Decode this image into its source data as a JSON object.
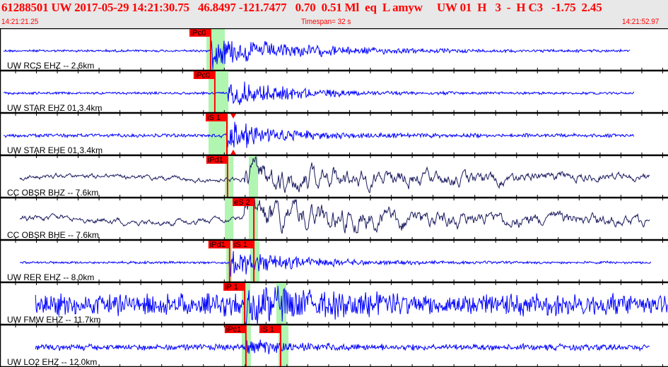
{
  "header": {
    "title": "61288501 UW 2017-05-29 14:21:30.75   46.8497 -121.7477   0.70  0.51 Ml  eq  L amyw     UW 01  H   3  -  H C3   -1.75  2.45",
    "start_time": "14:21:21.25",
    "timespan": "Timespan=  32 s",
    "end_time": "14:21:52.97"
  },
  "timespan_s": 32,
  "colors": {
    "header_text": "#ff0000",
    "trace_short": "#0000ff",
    "trace_broadband": "#1a1a5e",
    "pick": "#ff0000",
    "window": "#b0f5b0"
  },
  "traces": [
    {
      "label": "UW RCS EHZ -- 2.6km",
      "color": "#0000ff",
      "t0": 0.17,
      "t1": 30.2,
      "onset": 10.1,
      "noise": 2,
      "peak": 26,
      "decay": 4,
      "windows": [
        [
          9.89,
          10.77
        ]
      ],
      "picks": [
        {
          "label": "iPc0",
          "t": 10.09
        }
      ]
    },
    {
      "label": "UW STAR EHZ 01 3.4km",
      "color": "#0000ff",
      "t0": 0.17,
      "t1": 30.4,
      "onset": 10.9,
      "noise": 2,
      "peak": 22,
      "decay": 3,
      "windows": [
        [
          9.99,
          10.94
        ]
      ],
      "picks": [
        {
          "label": "iPc0",
          "t": 10.29
        }
      ]
    },
    {
      "label": "UW STAR EHE 01 3.4km",
      "color": "#0000ff",
      "t0": 0.17,
      "t1": 30.4,
      "onset": 10.9,
      "noise": 3,
      "peak": 24,
      "decay": 2.5,
      "windows": [
        [
          9.99,
          10.94
        ]
      ],
      "picks": [
        {
          "label": "iS 1",
          "t": 10.87
        }
      ]
    },
    {
      "label": "CC OBSR BHZ -- 7.6km",
      "color": "#1a1a5e",
      "t0": 0.95,
      "t1": 31.15,
      "onset": 11.7,
      "noise": 5,
      "peak": 24,
      "decay": 9,
      "smooth": true,
      "windows": [
        [
          10.77,
          11.18
        ],
        [
          11.92,
          12.36
        ]
      ],
      "picks": [
        {
          "label": "iPd1",
          "t": 10.9
        }
      ]
    },
    {
      "label": "CC OBSR BHE -- 7.6km",
      "color": "#1a1a5e",
      "t0": 0.95,
      "t1": 31.15,
      "onset": 11.7,
      "noise": 6,
      "peak": 26,
      "decay": 10,
      "smooth": true,
      "windows": [
        [
          10.77,
          11.18
        ],
        [
          11.92,
          12.36
        ]
      ],
      "picks": [
        {
          "label": "eS 2",
          "t": 12.16
        }
      ]
    },
    {
      "label": "UW RER EHZ -- 8.0km",
      "color": "#0000ff",
      "t0": 0.95,
      "t1": 31.2,
      "onset": 11.0,
      "noise": 2,
      "peak": 22,
      "decay": 3,
      "windows": [
        [
          10.84,
          11.11
        ],
        [
          11.99,
          12.43
        ]
      ],
      "picks": [
        {
          "label": "iPd1",
          "t": 11.0
        },
        {
          "label": "iS 1",
          "t": 12.16
        }
      ]
    },
    {
      "label": "UW FMW EHZ -- 11.7km",
      "color": "#0000ff",
      "t0": 1.7,
      "t1": 32,
      "onset": 11.7,
      "noise": 18,
      "peak": 22,
      "decay": 3,
      "windows": [
        [
          11.58,
          11.99
        ],
        [
          13.24,
          13.71
        ]
      ],
      "picks": [
        {
          "label": "iP 1",
          "t": 11.72
        }
      ]
    },
    {
      "label": "UW LO2 EHZ -- 12.0km",
      "color": "#0000ff",
      "t0": 1.7,
      "t1": 31.15,
      "onset": 11.8,
      "noise": 5,
      "peak": 12,
      "decay": 2,
      "windows": [
        [
          11.58,
          12.02
        ],
        [
          13.34,
          13.82
        ]
      ],
      "picks": [
        {
          "label": "iPc1",
          "t": 11.78
        },
        {
          "label": "iS 1",
          "t": 13.44
        }
      ]
    }
  ]
}
